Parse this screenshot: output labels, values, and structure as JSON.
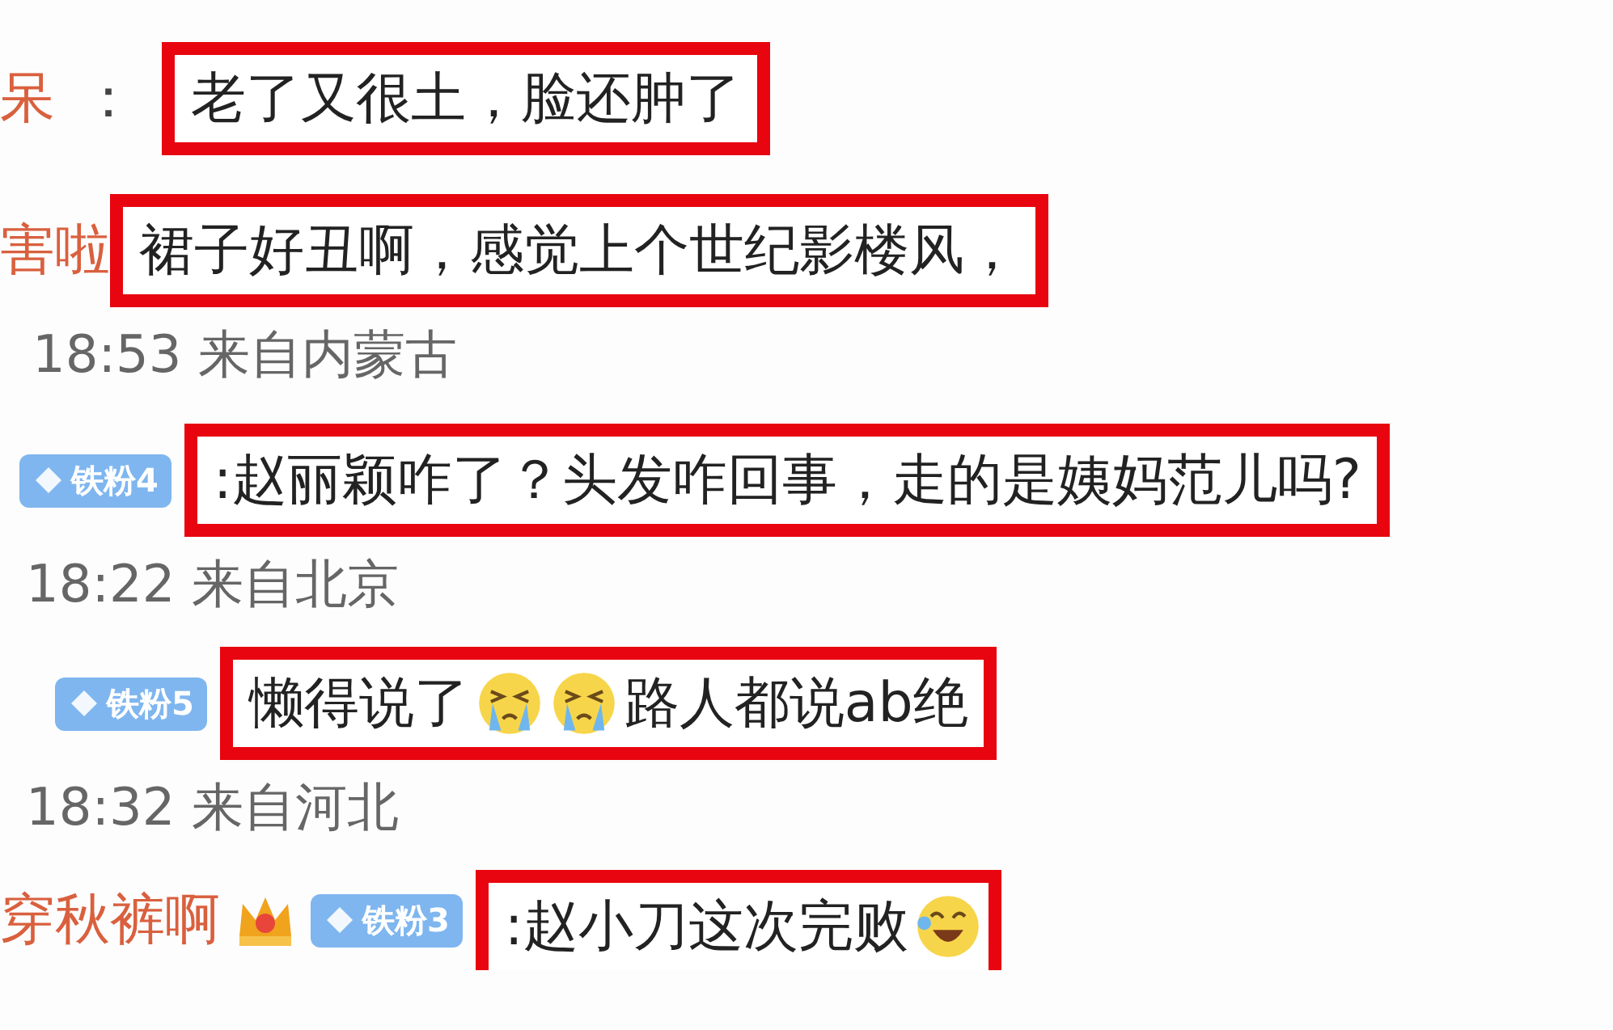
{
  "comments": [
    {
      "name": "呆",
      "separator": "：",
      "segments": [
        {
          "kind": "text",
          "text": "老了又很土，脸还肿了"
        }
      ]
    },
    {
      "name": "害啦",
      "segments": [
        {
          "kind": "text",
          "text": "裙子好丑啊，感觉上个世纪影楼风，"
        }
      ],
      "time": "18:53 来自内蒙古"
    },
    {
      "badges": [
        {
          "kind": "fan",
          "text": "铁粉4"
        }
      ],
      "segments": [
        {
          "kind": "text",
          "text": ":赵丽颖咋了？头发咋回事，走的是姨妈范儿吗?"
        }
      ],
      "time": "18:22 来自北京"
    },
    {
      "badges": [
        {
          "kind": "fan",
          "text": "铁粉5"
        }
      ],
      "segments": [
        {
          "kind": "text",
          "text": "懒得说了"
        },
        {
          "kind": "crying"
        },
        {
          "kind": "crying"
        },
        {
          "kind": "text",
          "text": "路人都说ab绝"
        }
      ],
      "time": "18:32 来自河北"
    },
    {
      "name": "穿秋裤啊",
      "badges": [
        {
          "kind": "crown"
        },
        {
          "kind": "fan",
          "text": "铁粉3"
        }
      ],
      "segments": [
        {
          "kind": "text",
          "text": ":赵小刀这次完败"
        },
        {
          "kind": "laughing"
        }
      ]
    }
  ]
}
